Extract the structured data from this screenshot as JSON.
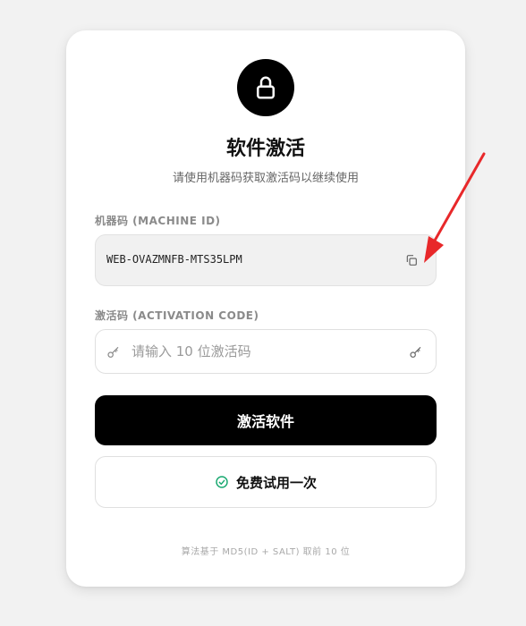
{
  "header": {
    "title": "软件激活",
    "subtitle": "请使用机器码获取激活码以继续使用"
  },
  "machine": {
    "label": "机器码 (MACHINE ID)",
    "value": "WEB-OVAZMNFB-MTS35LPM",
    "copy_icon": "copy-icon"
  },
  "activation": {
    "label": "激活码 (ACTIVATION CODE)",
    "placeholder": "请输入 10 位激活码",
    "value": "",
    "icon": "key-icon"
  },
  "buttons": {
    "activate_label": "激活软件",
    "trial_label": "免费试用一次",
    "trial_icon": "check-circle-icon"
  },
  "footer": {
    "note": "算法基于 MD5(ID + SALT) 取前 10 位"
  },
  "colors": {
    "accent": "#000000",
    "trial_check": "#1aa971",
    "arrow": "#e8282a"
  }
}
